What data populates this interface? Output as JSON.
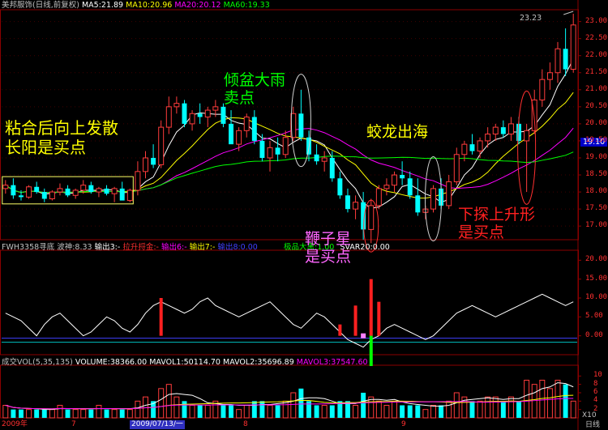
{
  "price_header": {
    "name": "美邦服饰(日线,前复权)",
    "ma5": "MA5:21.89",
    "ma10": "MA10:20.96",
    "ma20": "MA20:20.12",
    "ma60": "MA60:19.33"
  },
  "indicator_header": {
    "name": "FWH3358寻底",
    "wave": "波神:8.33",
    "out3": "输出3:-",
    "lift": "拉升捋金:-",
    "out6": "输出6:-",
    "out7": "输出7:-",
    "out8": "输出8:0.00",
    "jipin": "极品大黑:1.00",
    "svar": "SVAR20:0.00"
  },
  "volume_header": {
    "name": "成交VOL(5,35,135)",
    "volume": "VOLUME:38366.00",
    "mavol1": "MAVOL1:50114.70",
    "mavol2": "MAVOL2:35696.89",
    "mavol3": "MAVOL3:37547.60"
  },
  "annotations": {
    "zhanhe": [
      "粘合后向上发散",
      "长阳是买点"
    ],
    "qingpen": [
      "倾盆大雨",
      "卖点"
    ],
    "jiaolong": "蛟龙出海",
    "bianzixing": [
      "鞭子星",
      "是买点"
    ],
    "xiatan": [
      "下探上升形",
      "是买点"
    ]
  },
  "high_marker": "23.23",
  "current_price": "19.10",
  "price_axis": [
    "23.00",
    "22.50",
    "22.00",
    "21.50",
    "21.00",
    "20.50",
    "20.00",
    "19.50",
    "19.00",
    "18.50",
    "18.00",
    "17.50",
    "17.00"
  ],
  "indicator_axis": [
    "20.00",
    "15.00",
    "10.00",
    "5.00",
    "0.00"
  ],
  "volume_axis": [
    "10",
    "8",
    "6",
    "4",
    "2"
  ],
  "volume_unit": "X10",
  "date_axis": [
    "2009年",
    "7",
    "2009/07/13/一",
    "8",
    "9"
  ],
  "period_label": "日线",
  "colors": {
    "up": "#ff3c3c",
    "down": "#00ffff",
    "ma5": "#ffffff",
    "ma10": "#ffff00",
    "ma20": "#ff00ff",
    "ma60": "#00ff00",
    "grid": "#8b0000"
  },
  "chart_data": {
    "type": "candlestick",
    "series_note": "daily OHLC, 前复权",
    "candles": [
      [
        18.1,
        18.35,
        17.95,
        18.2
      ],
      [
        18.2,
        18.4,
        17.8,
        17.9
      ],
      [
        17.9,
        18.05,
        17.75,
        17.85
      ],
      [
        17.85,
        18.2,
        17.8,
        18.15
      ],
      [
        18.15,
        18.3,
        17.95,
        18.0
      ],
      [
        18.0,
        18.1,
        17.7,
        17.8
      ],
      [
        17.8,
        18.05,
        17.75,
        18.0
      ],
      [
        18.0,
        18.25,
        17.9,
        18.1
      ],
      [
        18.1,
        18.2,
        17.85,
        17.9
      ],
      [
        17.9,
        18.1,
        17.8,
        18.05
      ],
      [
        18.05,
        18.35,
        17.95,
        18.2
      ],
      [
        18.2,
        18.3,
        17.95,
        18.0
      ],
      [
        18.0,
        18.15,
        17.85,
        18.1
      ],
      [
        18.1,
        18.2,
        17.9,
        17.95
      ],
      [
        17.95,
        18.15,
        17.7,
        18.1
      ],
      [
        18.1,
        18.3,
        17.95,
        17.75
      ],
      [
        17.75,
        18.1,
        17.7,
        18.05
      ],
      [
        18.05,
        18.9,
        17.9,
        18.6
      ],
      [
        18.6,
        19.2,
        18.4,
        19.0
      ],
      [
        19.0,
        19.4,
        18.7,
        18.8
      ],
      [
        18.8,
        20.1,
        18.7,
        19.9
      ],
      [
        19.9,
        20.8,
        19.7,
        20.5
      ],
      [
        20.5,
        20.8,
        20.3,
        20.6
      ],
      [
        20.6,
        20.7,
        19.9,
        20.0
      ],
      [
        20.0,
        20.4,
        19.8,
        20.3
      ],
      [
        20.3,
        20.6,
        20.0,
        20.2
      ],
      [
        20.2,
        20.5,
        19.9,
        20.4
      ],
      [
        20.4,
        20.7,
        20.2,
        20.5
      ],
      [
        20.5,
        20.6,
        19.9,
        20.0
      ],
      [
        20.0,
        20.4,
        19.5,
        19.4
      ],
      [
        19.4,
        19.9,
        19.2,
        19.8
      ],
      [
        19.8,
        20.3,
        19.6,
        20.2
      ],
      [
        20.2,
        20.4,
        19.4,
        19.5
      ],
      [
        19.5,
        19.7,
        18.9,
        19.0
      ],
      [
        19.0,
        19.5,
        18.6,
        19.3
      ],
      [
        19.3,
        19.6,
        18.9,
        19.1
      ],
      [
        19.1,
        19.8,
        19.0,
        19.6
      ],
      [
        19.6,
        20.5,
        19.5,
        20.3
      ],
      [
        20.3,
        21.0,
        19.5,
        19.6
      ],
      [
        19.6,
        19.8,
        18.9,
        19.1
      ],
      [
        19.1,
        19.4,
        18.8,
        18.9
      ],
      [
        18.9,
        19.2,
        18.6,
        19.0
      ],
      [
        19.0,
        19.2,
        18.3,
        18.4
      ],
      [
        18.4,
        18.6,
        17.8,
        17.9
      ],
      [
        17.9,
        18.1,
        17.4,
        17.5
      ],
      [
        17.5,
        17.9,
        17.2,
        17.7
      ],
      [
        17.7,
        18.0,
        16.6,
        16.9
      ],
      [
        16.9,
        17.8,
        16.5,
        17.6
      ],
      [
        17.6,
        18.2,
        17.5,
        18.1
      ],
      [
        18.1,
        18.4,
        17.9,
        18.2
      ],
      [
        18.2,
        18.6,
        18.0,
        18.5
      ],
      [
        18.5,
        18.9,
        18.2,
        18.4
      ],
      [
        18.4,
        18.6,
        17.8,
        17.9
      ],
      [
        17.9,
        18.4,
        17.3,
        17.4
      ],
      [
        17.4,
        17.6,
        17.2,
        17.5
      ],
      [
        17.5,
        18.2,
        17.4,
        18.1
      ],
      [
        18.1,
        18.4,
        17.5,
        17.6
      ],
      [
        17.6,
        18.5,
        17.5,
        18.3
      ],
      [
        18.3,
        19.3,
        18.2,
        19.1
      ],
      [
        19.1,
        19.5,
        18.9,
        19.4
      ],
      [
        19.4,
        19.7,
        19.1,
        19.2
      ],
      [
        19.2,
        19.6,
        19.0,
        19.5
      ],
      [
        19.5,
        19.9,
        19.3,
        19.7
      ],
      [
        19.7,
        20.0,
        19.5,
        19.9
      ],
      [
        19.9,
        20.1,
        19.6,
        19.7
      ],
      [
        19.7,
        20.2,
        19.5,
        20.0
      ],
      [
        20.0,
        20.2,
        19.4,
        19.5
      ],
      [
        19.5,
        20.0,
        18.0,
        19.8
      ],
      [
        19.8,
        21.0,
        19.7,
        20.7
      ],
      [
        20.7,
        21.6,
        20.5,
        21.3
      ],
      [
        21.3,
        21.8,
        21.0,
        21.5
      ],
      [
        21.5,
        22.4,
        21.2,
        22.2
      ],
      [
        22.2,
        22.8,
        21.4,
        21.6
      ],
      [
        21.6,
        23.23,
        21.5,
        22.9
      ]
    ],
    "ma5_last": 21.89,
    "ma10_last": 20.96,
    "ma20_last": 20.12,
    "ma60_last": 19.33,
    "price_ylim": [
      16.6,
      23.3
    ],
    "indicator_line": [
      6,
      5,
      4,
      2,
      0,
      3,
      5,
      6,
      4,
      2,
      0,
      1,
      3,
      5,
      4,
      2,
      1,
      3,
      6,
      8,
      9,
      8,
      7,
      6,
      7,
      9,
      10,
      8,
      7,
      6,
      5,
      6,
      7,
      8,
      9,
      7,
      5,
      3,
      2,
      4,
      6,
      5,
      3,
      1,
      -1,
      -2,
      -3,
      -1,
      0,
      2,
      3,
      2,
      1,
      0,
      -1,
      0,
      2,
      4,
      6,
      7,
      8,
      7,
      6,
      5,
      6,
      7,
      8,
      9,
      10,
      11,
      10,
      9,
      8,
      9
    ],
    "indicator_ylim": [
      -5,
      22
    ],
    "indicator_red_bars": [
      [
        20,
        10
      ],
      [
        43,
        3
      ],
      [
        45,
        8
      ],
      [
        47,
        15
      ],
      [
        48,
        9
      ]
    ],
    "indicator_green_bars": [
      [
        47,
        -8
      ]
    ],
    "volume": [
      3,
      2,
      2,
      2,
      2,
      2,
      2,
      3,
      2,
      2,
      2,
      2,
      3,
      2,
      2,
      2,
      2,
      4,
      5,
      4,
      7,
      8,
      5,
      4,
      3,
      3,
      3,
      4,
      3,
      3,
      2,
      3,
      4,
      4,
      3,
      3,
      4,
      6,
      7,
      4,
      3,
      3,
      3,
      4,
      4,
      3,
      6,
      5,
      4,
      3,
      4,
      3,
      3,
      3,
      2,
      3,
      3,
      4,
      6,
      5,
      4,
      4,
      5,
      5,
      4,
      5,
      4,
      9,
      8,
      9,
      7,
      9,
      8,
      4
    ],
    "volume_ylim": [
      0,
      12
    ]
  }
}
